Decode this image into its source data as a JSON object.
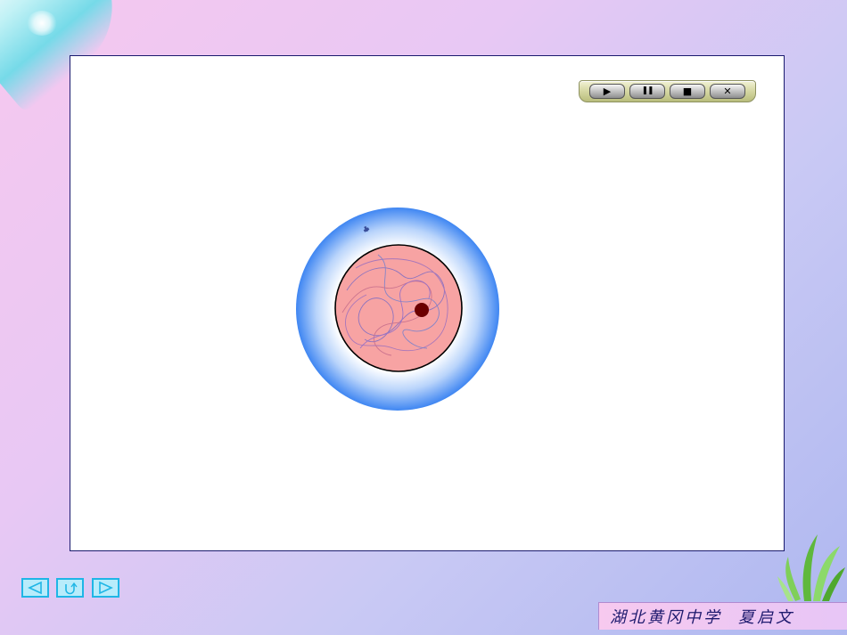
{
  "player": {
    "play_icon": "▶",
    "pause_icon": "❚❚",
    "stop_icon": "■",
    "close_icon": "✕"
  },
  "nav": {
    "prev_icon": "triangle-left-icon",
    "return_icon": "return-icon",
    "next_icon": "triangle-right-icon"
  },
  "footer": {
    "school": "湖北黄冈中学",
    "author": "夏启文"
  },
  "colors": {
    "stage_border": "#1a1a6e",
    "cell_outer": "#3f86f2",
    "nucleus_fill": "#f7a3a3",
    "nucleolus": "#6b0000",
    "nav_border": "#1fb6e6"
  }
}
